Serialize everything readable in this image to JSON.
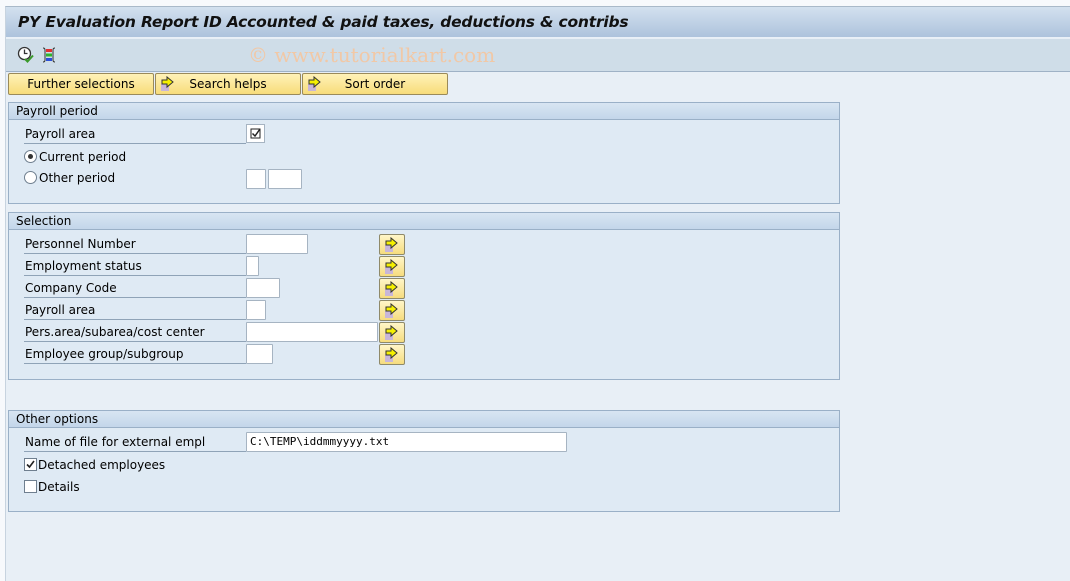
{
  "window": {
    "title": "PY Evaluation Report ID Accounted & paid taxes, deductions & contribs",
    "watermark": "© www.tutorialkart.com"
  },
  "toolbar": {
    "icons": [
      {
        "name": "execute-clock-icon",
        "tooltip": "Execute"
      },
      {
        "name": "selection-options-icon",
        "tooltip": "Selection options"
      }
    ]
  },
  "tabs": [
    {
      "label": "Further selections",
      "icon": null
    },
    {
      "label": "Search helps",
      "icon": "arrow-right-icon"
    },
    {
      "label": "Sort order",
      "icon": "arrow-right-icon"
    }
  ],
  "payroll_period": {
    "header": "Payroll period",
    "payroll_area_label": "Payroll area",
    "payroll_area_checked": true,
    "current_period_label": "Current period",
    "current_period_selected": true,
    "other_period_label": "Other period",
    "other_period_selected": false,
    "other_period_value1": "",
    "other_period_value2": ""
  },
  "selection": {
    "header": "Selection",
    "rows": [
      {
        "label": "Personnel Number",
        "value": ""
      },
      {
        "label": "Employment status",
        "value": ""
      },
      {
        "label": "Company Code",
        "value": ""
      },
      {
        "label": "Payroll area",
        "value": ""
      },
      {
        "label": "Pers.area/subarea/cost center",
        "value": ""
      },
      {
        "label": "Employee group/subgroup",
        "value": ""
      }
    ]
  },
  "other_options": {
    "header": "Other options",
    "file_label": "Name of file for external empl",
    "file_value": "C:\\TEMP\\iddmmyyyy.txt",
    "detached_label": "Detached employees",
    "detached_checked": true,
    "details_label": "Details",
    "details_checked": false
  },
  "colors": {
    "title_bar_top": "#d3e1ef",
    "title_bar_bottom": "#adc3dc",
    "button_yellow": "#f7dc7a",
    "group_background": "#dfeaf4",
    "page_background": "#e8eff6"
  }
}
